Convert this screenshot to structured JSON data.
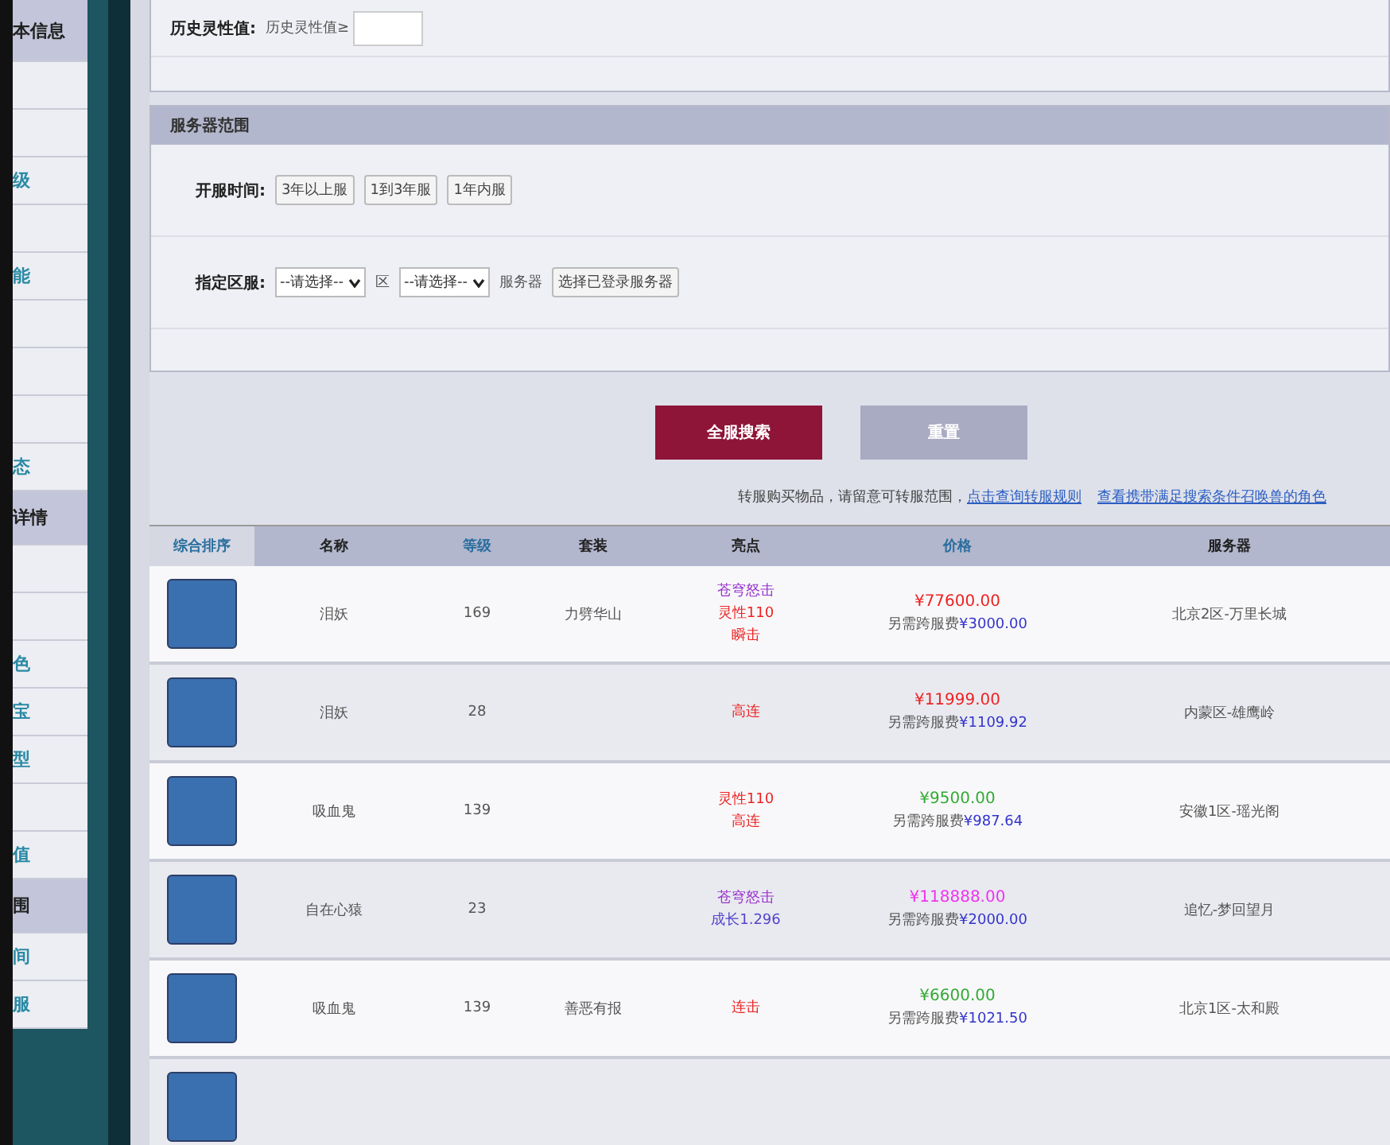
{
  "sidebar": {
    "items": [
      {
        "kind": "header",
        "label": "本信息"
      },
      {
        "kind": "item"
      },
      {
        "kind": "item"
      },
      {
        "kind": "item",
        "label": "级"
      },
      {
        "kind": "item"
      },
      {
        "kind": "item",
        "label": "能"
      },
      {
        "kind": "item"
      },
      {
        "kind": "item"
      },
      {
        "kind": "item"
      },
      {
        "kind": "item",
        "label": "态"
      },
      {
        "kind": "header",
        "label": "详情"
      },
      {
        "kind": "item"
      },
      {
        "kind": "item"
      },
      {
        "kind": "item",
        "label": "色"
      },
      {
        "kind": "item",
        "label": "宝"
      },
      {
        "kind": "item",
        "label": "型"
      },
      {
        "kind": "item"
      },
      {
        "kind": "item",
        "label": "值"
      },
      {
        "kind": "header",
        "label": "围"
      },
      {
        "kind": "item",
        "label": "间"
      },
      {
        "kind": "item",
        "label": "服"
      }
    ]
  },
  "history_spirit": {
    "label": "历史灵性值:",
    "prefix": "历史灵性值≥"
  },
  "server_range": {
    "title": "服务器范围",
    "open_time": {
      "label": "开服时间:",
      "options": [
        "3年以上服",
        "1到3年服",
        "1年内服"
      ]
    },
    "server": {
      "label": "指定区服:",
      "area_select": "--请选择--",
      "area_label": "区",
      "server_select": "--请选择--",
      "server_label": "服务器",
      "pick_button": "选择已登录服务器"
    }
  },
  "actions": {
    "search": "全服搜索",
    "reset": "重置"
  },
  "notice": {
    "text": "转服购买物品，请留意可转服范围，",
    "rules_link": "点击查询转服规则",
    "roles_link": "查看携带满足搜索条件召唤兽的角色"
  },
  "table": {
    "columns": [
      {
        "label": "综合排序",
        "kind": "sort",
        "selected": true
      },
      {
        "label": "名称",
        "kind": "plain"
      },
      {
        "label": "等级",
        "kind": "sortable"
      },
      {
        "label": "套装",
        "kind": "plain"
      },
      {
        "label": "亮点",
        "kind": "plain"
      },
      {
        "label": "价格",
        "kind": "sortable"
      },
      {
        "label": "服务器",
        "kind": "plain"
      }
    ],
    "rows": [
      {
        "name": "泪妖",
        "level": "169",
        "suit": "力劈华山",
        "highlights": [
          {
            "text": "苍穹怒击",
            "color": "#9933cc"
          },
          {
            "text": "灵性110",
            "color": "#ee2222"
          },
          {
            "text": "瞬击",
            "color": "#ee2222"
          }
        ],
        "price": {
          "text": "¥77600.00",
          "color": "#ee2222"
        },
        "fee_label": "另需跨服费",
        "fee": "¥3000.00",
        "server": "北京2区-万里长城"
      },
      {
        "name": "泪妖",
        "level": "28",
        "highlights": [
          {
            "text": "高连",
            "color": "#ee2222"
          }
        ],
        "price": {
          "text": "¥11999.00",
          "color": "#ee2222"
        },
        "fee_label": "另需跨服费",
        "fee": "¥1109.92",
        "server": "内蒙区-雄鹰岭"
      },
      {
        "name": "吸血鬼",
        "level": "139",
        "highlights": [
          {
            "text": "灵性110",
            "color": "#ee2222"
          },
          {
            "text": "高连",
            "color": "#ee2222"
          }
        ],
        "price": {
          "text": "¥9500.00",
          "color": "#33aa33"
        },
        "fee_label": "另需跨服费",
        "fee": "¥987.64",
        "server": "安徽1区-瑶光阁"
      },
      {
        "name": "自在心猿",
        "level": "23",
        "highlights": [
          {
            "text": "苍穹怒击",
            "color": "#9933cc"
          },
          {
            "text": "成长1.296",
            "color": "#5544cc"
          }
        ],
        "price": {
          "text": "¥118888.00",
          "color": "#ee33ee"
        },
        "fee_label": "另需跨服费",
        "fee": "¥2000.00",
        "server": "追忆-梦回望月"
      },
      {
        "name": "吸血鬼",
        "level": "139",
        "suit": "善恶有报",
        "highlights": [
          {
            "text": "连击",
            "color": "#ee2222"
          }
        ],
        "price": {
          "text": "¥6600.00",
          "color": "#33aa33"
        },
        "fee_label": "另需跨服费",
        "fee": "¥1021.50",
        "server": "北京1区-太和殿"
      },
      {
        "kind": "cut_off"
      }
    ]
  }
}
